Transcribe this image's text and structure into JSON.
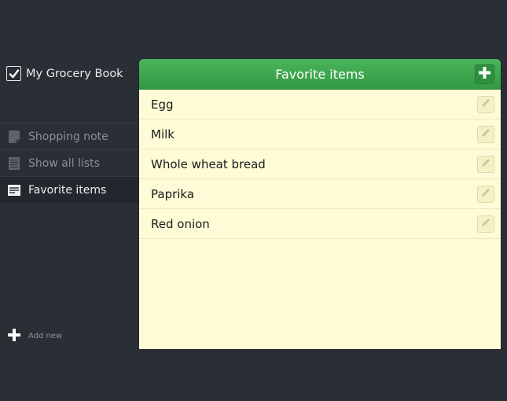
{
  "app": {
    "title": "My Grocery Book"
  },
  "sidebar": {
    "items": [
      {
        "label": "Shopping note",
        "icon": "note-icon"
      },
      {
        "label": "Show all lists",
        "icon": "list-icon"
      },
      {
        "label": "Favorite items",
        "icon": "favorites-icon",
        "active": true
      }
    ],
    "add_new_label": "Add new"
  },
  "panel": {
    "title": "Favorite items",
    "items": [
      {
        "name": "Egg"
      },
      {
        "name": "Milk"
      },
      {
        "name": "Whole wheat bread"
      },
      {
        "name": "Paprika"
      },
      {
        "name": "Red onion"
      }
    ]
  },
  "colors": {
    "background": "#2a2f36",
    "header_green": "#3fa84f",
    "panel_bg": "#fefcd6"
  }
}
